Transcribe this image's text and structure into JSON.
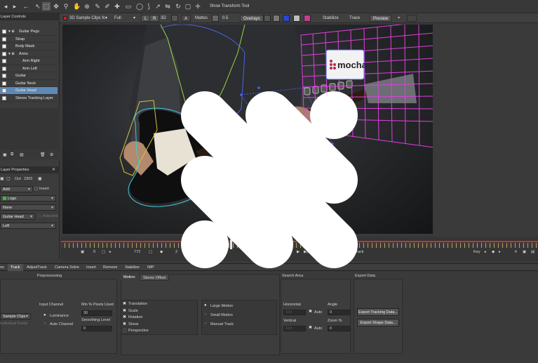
{
  "toolbar": {
    "show_transform_tool": "Show Transform Tool"
  },
  "subbar": {
    "clip_name": "3D Sample Clips fc",
    "view_mode": "Full",
    "btn_l": "L",
    "btn_r": "R",
    "btn_3d": "3D",
    "mattes_label": "Mattes",
    "opacity_value": "0.5",
    "overlays_label": "Overlays",
    "stabilize_label": "Stabilize",
    "trace_label": "Trace",
    "preview_label": "Preview"
  },
  "layer_controls": {
    "header": "Layer Controls",
    "layers": [
      {
        "name": "Guitar Pegs",
        "indent": 1,
        "group": true
      },
      {
        "name": "Strap",
        "indent": 0,
        "group": false
      },
      {
        "name": "Body Mask",
        "indent": 0,
        "group": false
      },
      {
        "name": "Arms",
        "indent": 1,
        "group": true
      },
      {
        "name": "Arm Right",
        "indent": 2,
        "group": false
      },
      {
        "name": "Arm Left",
        "indent": 2,
        "group": false
      },
      {
        "name": "Guitar",
        "indent": 0,
        "group": false
      },
      {
        "name": "Guitar Neck",
        "indent": 0,
        "group": false
      },
      {
        "name": "Guitar Head",
        "indent": 0,
        "group": false,
        "selected": true
      },
      {
        "name": "Stereo Tracking Layer",
        "indent": 0,
        "group": false
      }
    ]
  },
  "layer_properties": {
    "header": "Layer Properties",
    "out_label": "Out",
    "out_value": "2303",
    "blend_mode": "Add",
    "invert_label": "Invert",
    "insert_clip": "Logo",
    "link_none": "None",
    "linked_layer": "Guitar Head",
    "adjusted_label": "Adjusted",
    "view_left": "Left"
  },
  "timeline": {
    "frame_start": "0",
    "frame_in": "772",
    "frame_current": "2",
    "track_label": "Track",
    "key_label": "Key"
  },
  "tabs": [
    "ns",
    "Track",
    "AdjustTrack",
    "Camera Solve",
    "Insert",
    "Remove",
    "Stabilize",
    "IMP"
  ],
  "active_tab": "Track",
  "track_panel": {
    "preprocessing_label": "Preprocessing",
    "input_channel_label": "Input Channel",
    "luminance_label": "Luminance",
    "auto_channel_label": "Auto Channel",
    "min_pixels_label": "Min % Pixels Used",
    "min_pixels_value": "30",
    "smoothing_label": "Smoothing Level",
    "smoothing_value": "0",
    "clip_select": "Sample Clips",
    "individual_fields": "Individual Fields",
    "motion_label": "Motion",
    "stereo_offset_label": "Stereo Offset",
    "motion_options": [
      "Translation",
      "Scale",
      "Rotation",
      "Shear",
      "Perspective"
    ],
    "motion_types": [
      "Large Motion",
      "Small Motion",
      "Manual Track"
    ],
    "search_area_label": "Search Area",
    "horizontal_label": "Horizontal",
    "vertical_label": "Vertical",
    "auto_label": "Auto",
    "angle_label": "Angle",
    "angle_value": "0",
    "zoom_label": "Zoom %",
    "zoom_value": "0",
    "horizontal_value": "100",
    "vertical_value": "100",
    "export_data_label": "Export Data",
    "export_tracking": "Export Tracking Data...",
    "export_shape": "Export Shape Data..."
  },
  "viewer": {
    "sign_text": "mocha"
  },
  "colors": {
    "accent": "#5d89b8",
    "timeline_red": "#c43530",
    "grid_magenta": "#e040e0",
    "spline_yellow": "#d8c440",
    "spline_green": "#9cd640",
    "spline_cyan": "#40c8d8",
    "spline_blue": "#4a64e8"
  }
}
